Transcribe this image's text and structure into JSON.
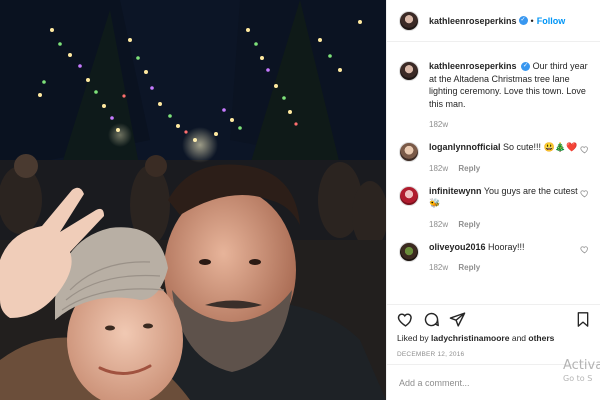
{
  "post": {
    "username": "kathleenroseperkins",
    "follow_label": "Follow",
    "separator": "•",
    "caption": "Our third year at the Altadena Christmas tree lane lighting ceremony. Love this town. Love this man.",
    "caption_time": "182w"
  },
  "comments": [
    {
      "username": "loganlynnofficial",
      "text": "So cute!!! 😃🎄❤️",
      "time": "182w",
      "reply_label": "Reply"
    },
    {
      "username": "infinitewynn",
      "text": "You guys are the cutest 🐝",
      "time": "182w",
      "reply_label": "Reply"
    },
    {
      "username": "oliveyou2016",
      "text": "Hooray!!!",
      "time": "182w",
      "reply_label": "Reply"
    }
  ],
  "likes": {
    "prefix": "Liked by",
    "user": "ladychristinamoore",
    "conjunction": "and",
    "others": "others"
  },
  "date": "DECEMBER 12, 2016",
  "add_comment_placeholder": "Add a comment...",
  "watermark": {
    "line1": "Activa",
    "line2": "Go to S"
  },
  "icons": [
    "heart-icon",
    "comment-icon",
    "share-icon",
    "bookmark-icon",
    "verified-icon"
  ],
  "colors": {
    "accent": "#0095f6",
    "verified": "#3897f0",
    "muted": "#8e8e8e",
    "text": "#262626"
  }
}
